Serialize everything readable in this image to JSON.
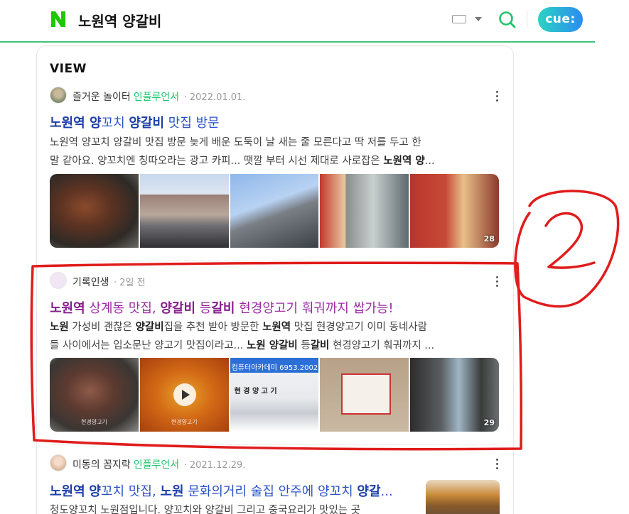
{
  "header": {
    "logo": "N",
    "query": "노원역 양갈비",
    "cue_label": "cue:"
  },
  "section_title": "VIEW",
  "posts": [
    {
      "author": "즐거운 놀이터",
      "badge": "인플루언서",
      "date": "· 2022.01.01.",
      "title_parts": [
        "노원역 양",
        "꼬치 ",
        "양갈비",
        " 맛집 방문"
      ],
      "desc_line1": "노원역 양꼬치 양갈비 맛집 방문 늦게 배운 도둑이 날 새는 줄 모른다고 딱 저를 두고 한",
      "desc_line2a": "말 같아요. 양꼬치엔 칭따오라는 광고 카피... 땟깔 부터 시선 제대로 사로잡은 ",
      "desc_line2b": "노원역 양",
      "desc_line2c": "...",
      "photo_count": "28"
    },
    {
      "author": "기록인생",
      "date": "· 2일 전",
      "title_parts": [
        "노원역",
        " 상계동 맛집, ",
        "양갈비",
        " 등",
        "갈비",
        " 현경양고기 훠궈까지 쌉가능!"
      ],
      "desc_l1_b1": "노원",
      "desc_l1_t1": " 가성비 괜찮은 ",
      "desc_l1_b2": "양갈비",
      "desc_l1_t2": "집을 추천 받아 방문한 ",
      "desc_l1_b3": "노원역",
      "desc_l1_t3": " 맛집 현경양고기 이미 동네사람",
      "desc_l2_t1": "들 사이에서는 입소문난 양고기 맛집이라고... ",
      "desc_l2_b1": "노원 양갈비",
      "desc_l2_t2": " 등",
      "desc_l2_b2": "갈비",
      "desc_l2_t3": " 현경양고기 훠궈까지 ...",
      "thumb_captions": [
        "현경양고기",
        "현경양고기"
      ],
      "sign_text": "컴퓨터아카데미 6953.2002",
      "sign_text2": "현 경 양 고 기",
      "photo_count": "29"
    },
    {
      "author": "미동의 꼼지락",
      "badge": "인플루언서",
      "date": "· 2021.12.29.",
      "title_parts": [
        "노원역",
        " ",
        "양",
        "꼬치 맛집, ",
        "노원",
        " 문화의거리 술집 안주에 양꼬치 ",
        "양갈",
        "..."
      ],
      "desc_line1": "청도양꼬치 노원점입니다. 양꼬치와 양갈비 그리고 중국요리가 맛있는 곳"
    }
  ],
  "annotation": {
    "label": "2",
    "color": "#e01c1c"
  },
  "colors": {
    "green": "#03c75a",
    "link": "#2a52c7",
    "visited": "#9b2ca3",
    "influencer": "#1ec46b"
  }
}
